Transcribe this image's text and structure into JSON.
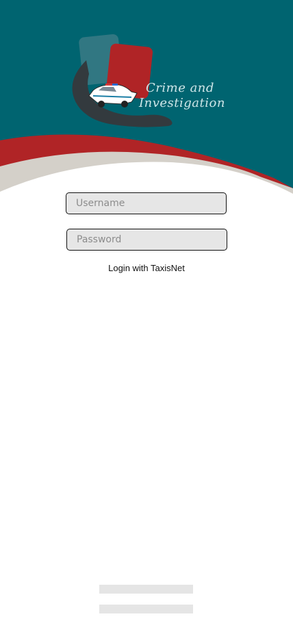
{
  "app": {
    "logo_line1": "Crime and",
    "logo_line2": "Investigation"
  },
  "login": {
    "username_placeholder": "Username",
    "password_placeholder": "Password",
    "login_link_label": "Login with TaxisNet"
  },
  "colors": {
    "teal": "#006470",
    "red": "#b02426",
    "beige": "#d4d0c9",
    "field_bg": "#e6e6e6"
  },
  "icons": [
    "police-car-icon"
  ]
}
